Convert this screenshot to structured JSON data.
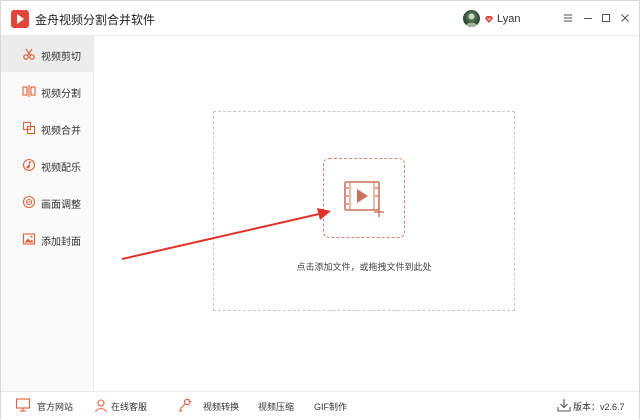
{
  "app": {
    "title": "金舟视频分割合并软件",
    "logo_icon": "play-logo-icon",
    "brand_color": "#e0473a"
  },
  "user": {
    "name": "Lyan",
    "vip_icon": "vip-heart-icon"
  },
  "window_controls": {
    "menu_icon": "hamburger-menu-icon",
    "minimize_icon": "minimize-icon",
    "maximize_icon": "maximize-icon",
    "close_icon": "close-icon"
  },
  "sidebar": {
    "items": [
      {
        "label": "视频剪切",
        "icon": "scissors-icon",
        "active": true
      },
      {
        "label": "视频分割",
        "icon": "split-icon",
        "active": false
      },
      {
        "label": "视频合并",
        "icon": "merge-icon",
        "active": false
      },
      {
        "label": "视频配乐",
        "icon": "music-note-icon",
        "active": false
      },
      {
        "label": "画面调整",
        "icon": "adjust-icon",
        "active": false
      },
      {
        "label": "添加封面",
        "icon": "image-icon",
        "active": false
      }
    ]
  },
  "main": {
    "drop_hint": "点击添加文件，或拖拽文件到此处",
    "add_icon": "add-video-icon",
    "accent_color": "#d4876e",
    "arrow_color": "#e2302a"
  },
  "footer": {
    "items": [
      {
        "label": "官方网站",
        "icon": "monitor-icon"
      },
      {
        "label": "在线客服",
        "icon": "support-icon"
      },
      {
        "label": "视频转换",
        "icon": "convert-icon"
      },
      {
        "label": "视频压缩",
        "icon": ""
      },
      {
        "label": "GIF制作",
        "icon": ""
      }
    ],
    "version_label": "版本：v2.6.7",
    "update_icon": "download-icon"
  }
}
